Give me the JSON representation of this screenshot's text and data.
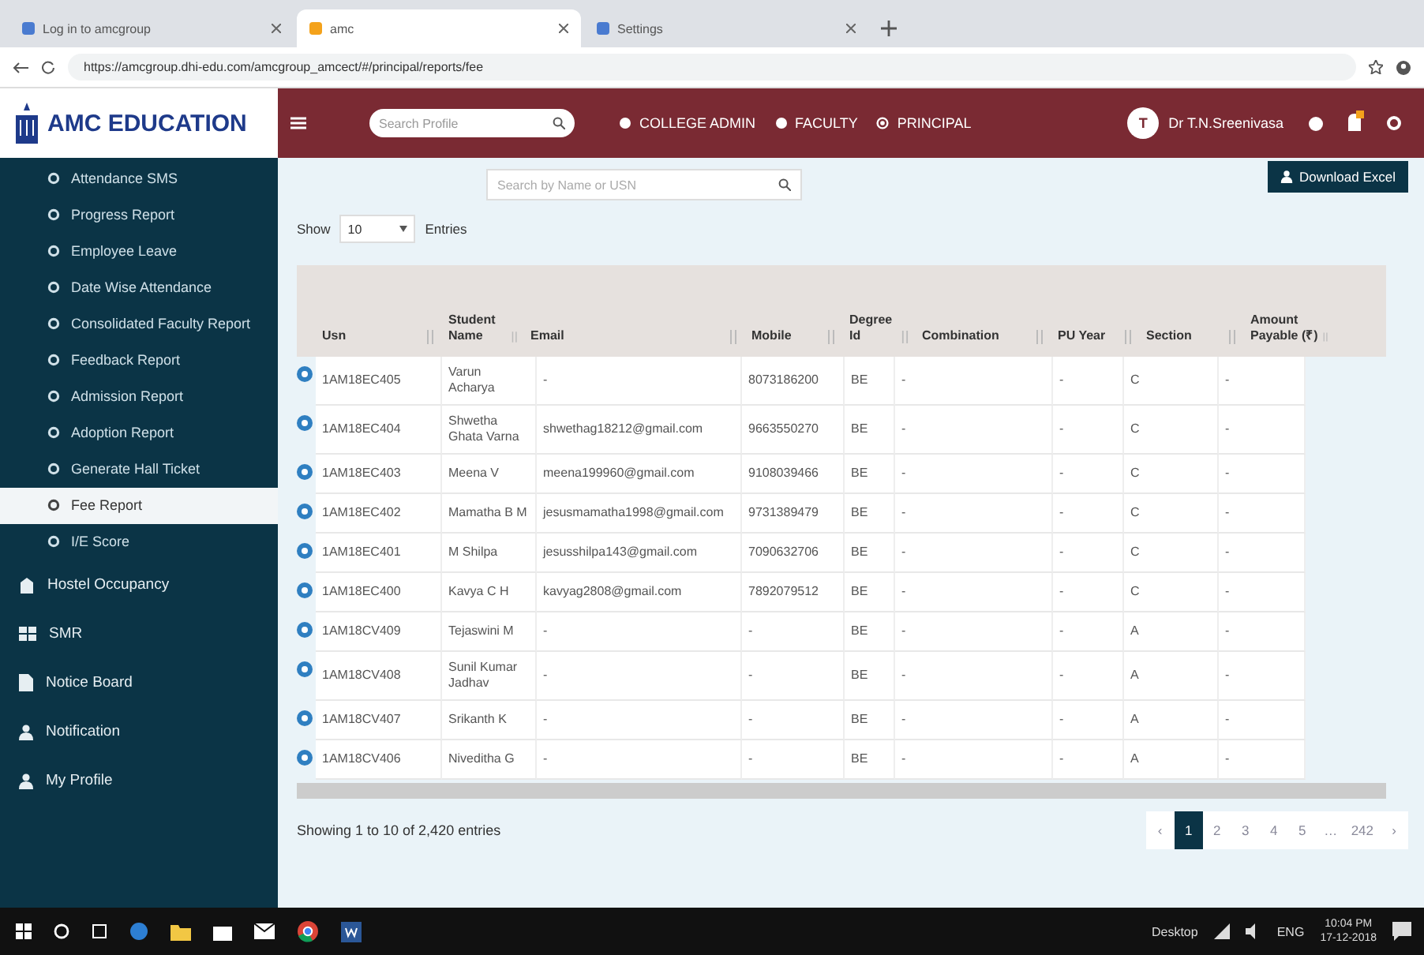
{
  "browser": {
    "tabs": [
      {
        "title": "Log in to amcgroup",
        "selected": false
      },
      {
        "title": "amc",
        "selected": true
      },
      {
        "title": "Settings",
        "selected": false
      }
    ],
    "url": "https://amcgroup.dhi-edu.com/amcgroup_amcect/#/principal/reports/fee"
  },
  "header": {
    "brand": "AMC EDUCATION",
    "search_placeholder": "Search Profile",
    "roles": [
      {
        "label": "COLLEGE ADMIN",
        "selected": false
      },
      {
        "label": "FACULTY",
        "selected": false
      },
      {
        "label": "PRINCIPAL",
        "selected": true
      }
    ],
    "user": {
      "initial": "T",
      "name": "Dr T.N.Sreenivasa"
    }
  },
  "sidebar": {
    "submenu": [
      {
        "label": "Attendance SMS",
        "selected": false
      },
      {
        "label": "Progress Report",
        "selected": false
      },
      {
        "label": "Employee Leave",
        "selected": false
      },
      {
        "label": "Date Wise Attendance",
        "selected": false
      },
      {
        "label": "Consolidated Faculty Report",
        "selected": false
      },
      {
        "label": "Feedback Report",
        "selected": false
      },
      {
        "label": "Admission Report",
        "selected": false
      },
      {
        "label": "Adoption Report",
        "selected": false
      },
      {
        "label": "Generate Hall Ticket",
        "selected": false
      },
      {
        "label": "Fee Report",
        "selected": true
      },
      {
        "label": "I/E Score",
        "selected": false
      }
    ],
    "menu": [
      {
        "label": "Hostel Occupancy",
        "kind": "building"
      },
      {
        "label": "SMR",
        "kind": "grid"
      },
      {
        "label": "Notice Board",
        "kind": "document"
      },
      {
        "label": "Notification",
        "kind": "person"
      },
      {
        "label": "My Profile",
        "kind": "person"
      }
    ]
  },
  "content": {
    "search_placeholder": "Search by Name or USN",
    "download_label": "Download Excel",
    "show_label": "Show",
    "entries_value": "10",
    "entries_label": "Entries",
    "table": {
      "columns": [
        "Usn",
        "Student Name",
        "Email",
        "Mobile",
        "Degree Id",
        "Combination",
        "PU Year",
        "Section",
        "Amount Payable (₹)"
      ],
      "rows": [
        {
          "cells": [
            "1AM18EC405",
            "Varun Acharya",
            "-",
            "8073186200",
            "BE",
            "-",
            "-",
            "C",
            "-"
          ]
        },
        {
          "cells": [
            "1AM18EC404",
            "Shwetha Ghata Varna",
            "shwethag18212@gmail.com",
            "9663550270",
            "BE",
            "-",
            "-",
            "C",
            "-"
          ]
        },
        {
          "cells": [
            "1AM18EC403",
            "Meena V",
            "meena199960@gmail.com",
            "9108039466",
            "BE",
            "-",
            "-",
            "C",
            "-"
          ]
        },
        {
          "cells": [
            "1AM18EC402",
            "Mamatha B M",
            "jesusmamatha1998@gmail.com",
            "9731389479",
            "BE",
            "-",
            "-",
            "C",
            "-"
          ]
        },
        {
          "cells": [
            "1AM18EC401",
            "M Shilpa",
            "jesusshilpa143@gmail.com",
            "7090632706",
            "BE",
            "-",
            "-",
            "C",
            "-"
          ]
        },
        {
          "cells": [
            "1AM18EC400",
            "Kavya C H",
            "kavyag2808@gmail.com",
            "7892079512",
            "BE",
            "-",
            "-",
            "C",
            "-"
          ]
        },
        {
          "cells": [
            "1AM18CV409",
            "Tejaswini M",
            "-",
            "-",
            "BE",
            "-",
            "-",
            "A",
            "-"
          ]
        },
        {
          "cells": [
            "1AM18CV408",
            "Sunil Kumar Jadhav",
            "-",
            "-",
            "BE",
            "-",
            "-",
            "A",
            "-"
          ]
        },
        {
          "cells": [
            "1AM18CV407",
            "Srikanth K",
            "-",
            "-",
            "BE",
            "-",
            "-",
            "A",
            "-"
          ]
        },
        {
          "cells": [
            "1AM18CV406",
            "Niveditha G",
            "-",
            "-",
            "BE",
            "-",
            "-",
            "A",
            "-"
          ]
        }
      ]
    },
    "footer": "Showing 1 to 10 of 2,420 entries",
    "pages": [
      {
        "label": "‹",
        "selected": false
      },
      {
        "label": "1",
        "selected": true
      },
      {
        "label": "2",
        "selected": false
      },
      {
        "label": "3",
        "selected": false
      },
      {
        "label": "4",
        "selected": false
      },
      {
        "label": "5",
        "selected": false
      },
      {
        "label": "…",
        "selected": false
      },
      {
        "label": "242",
        "selected": false
      },
      {
        "label": "›",
        "selected": false
      }
    ]
  },
  "taskbar": {
    "desktop_label": "Desktop",
    "language": "ENG",
    "time": "10:04 PM",
    "date": "17-12-2018"
  }
}
